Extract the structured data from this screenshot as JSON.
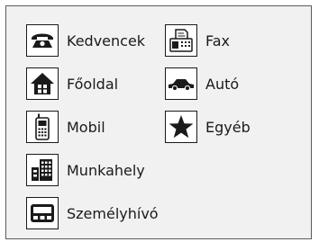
{
  "categories": {
    "favorites": {
      "label": "Kedvencek",
      "icon": "telephone-icon"
    },
    "fax": {
      "label": "Fax",
      "icon": "fax-icon"
    },
    "home": {
      "label": "Főoldal",
      "icon": "home-icon"
    },
    "car": {
      "label": "Autó",
      "icon": "car-icon"
    },
    "mobile": {
      "label": "Mobil",
      "icon": "mobile-phone-icon"
    },
    "other": {
      "label": "Egyéb",
      "icon": "star-icon"
    },
    "work": {
      "label": "Munkahely",
      "icon": "office-building-icon"
    },
    "pager": {
      "label": "Személyhívó",
      "icon": "pager-icon"
    }
  },
  "colors": {
    "panel_background": "#f1f1f1",
    "border": "#5a5a5a",
    "icon": "#1a1a1a"
  }
}
